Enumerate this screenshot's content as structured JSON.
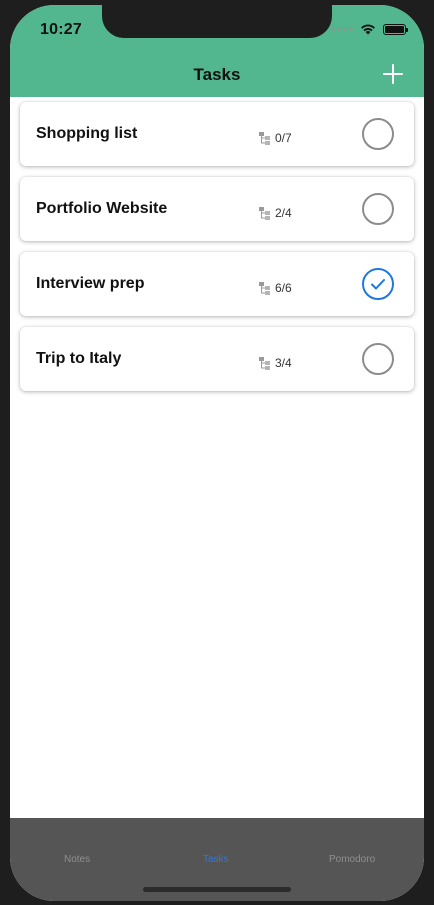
{
  "status_bar": {
    "time": "10:27"
  },
  "nav": {
    "title": "Tasks",
    "add_icon": "plus-icon"
  },
  "tasks": [
    {
      "title": "Shopping list",
      "subtasks": "0/7",
      "completed": false
    },
    {
      "title": "Portfolio Website",
      "subtasks": "2/4",
      "completed": false
    },
    {
      "title": "Interview prep",
      "subtasks": "6/6",
      "completed": true
    },
    {
      "title": "Trip to Italy",
      "subtasks": "3/4",
      "completed": false
    }
  ],
  "tabs": [
    {
      "label": "Notes",
      "active": false
    },
    {
      "label": "Tasks",
      "active": true
    },
    {
      "label": "Pomodoro",
      "active": false
    }
  ],
  "colors": {
    "header": "#52b78e",
    "accent": "#1f78e0",
    "tabbar": "#555555"
  }
}
